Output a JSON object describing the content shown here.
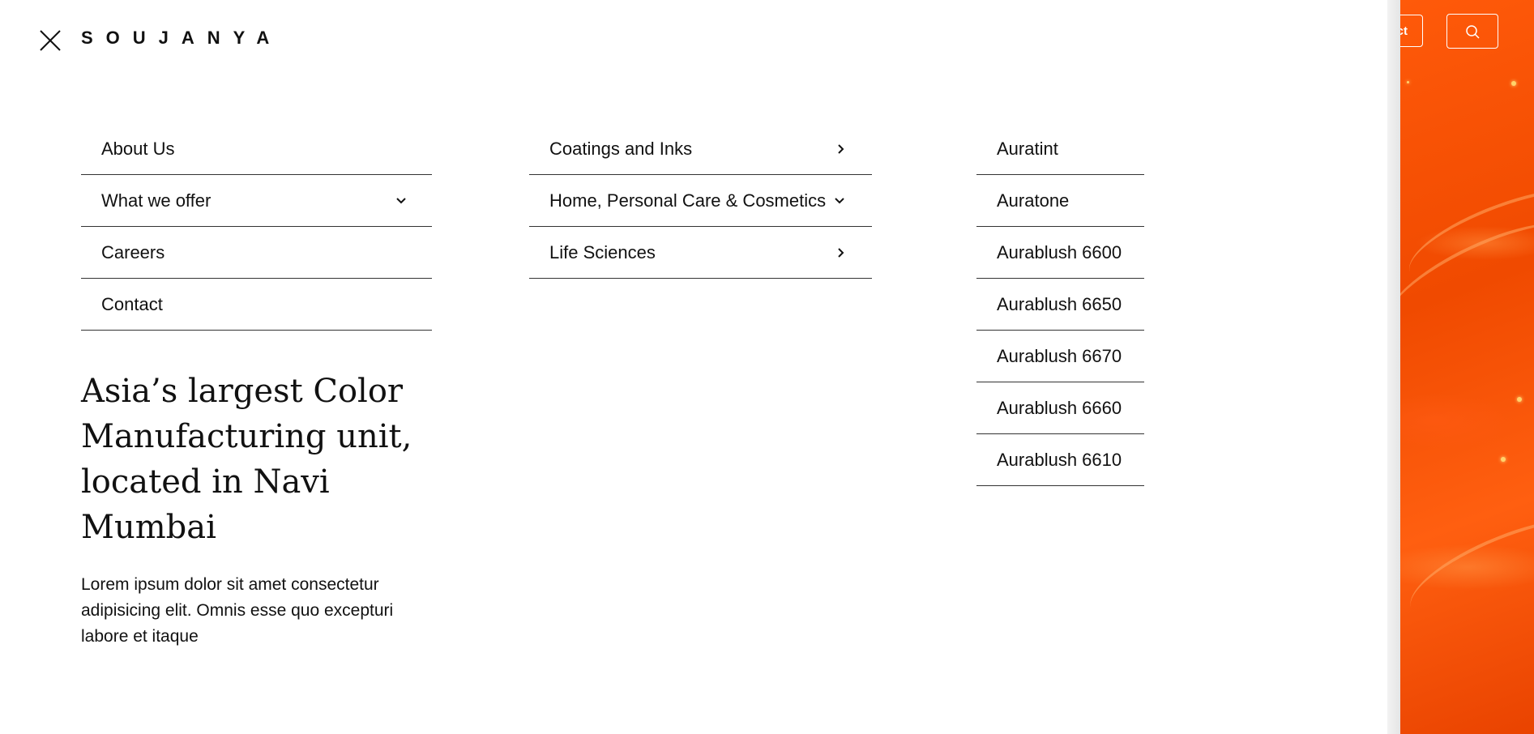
{
  "header": {
    "logo": "SOUJANYA",
    "contact_label": "ct"
  },
  "menu": {
    "main": [
      {
        "label": "About Us",
        "icon": ""
      },
      {
        "label": "What we offer",
        "icon": "chevron-down-icon"
      },
      {
        "label": "Careers",
        "icon": ""
      },
      {
        "label": "Contact",
        "icon": ""
      }
    ],
    "offerings": [
      {
        "label": "Coatings and Inks",
        "icon": "chevron-right-icon"
      },
      {
        "label": "Home, Personal Care & Cosmetics",
        "icon": "chevron-down-icon"
      },
      {
        "label": "Life Sciences",
        "icon": "chevron-right-icon"
      }
    ],
    "products": [
      {
        "label": "Auratint"
      },
      {
        "label": "Auratone"
      },
      {
        "label": "Aurablush 6600"
      },
      {
        "label": "Aurablush 6650"
      },
      {
        "label": "Aurablush 6670"
      },
      {
        "label": "Aurablush 6660"
      },
      {
        "label": "Aurablush 6610"
      }
    ]
  },
  "promo": {
    "headline": "Asia’s largest Color Manufacturing unit, located in Navi Mumbai",
    "body": "Lorem ipsum dolor sit amet consectetur adipisicing elit. Omnis esse quo excepturi labore et itaque"
  },
  "colors": {
    "accent": "#f04a00",
    "text": "#111111",
    "rule": "#333333"
  }
}
